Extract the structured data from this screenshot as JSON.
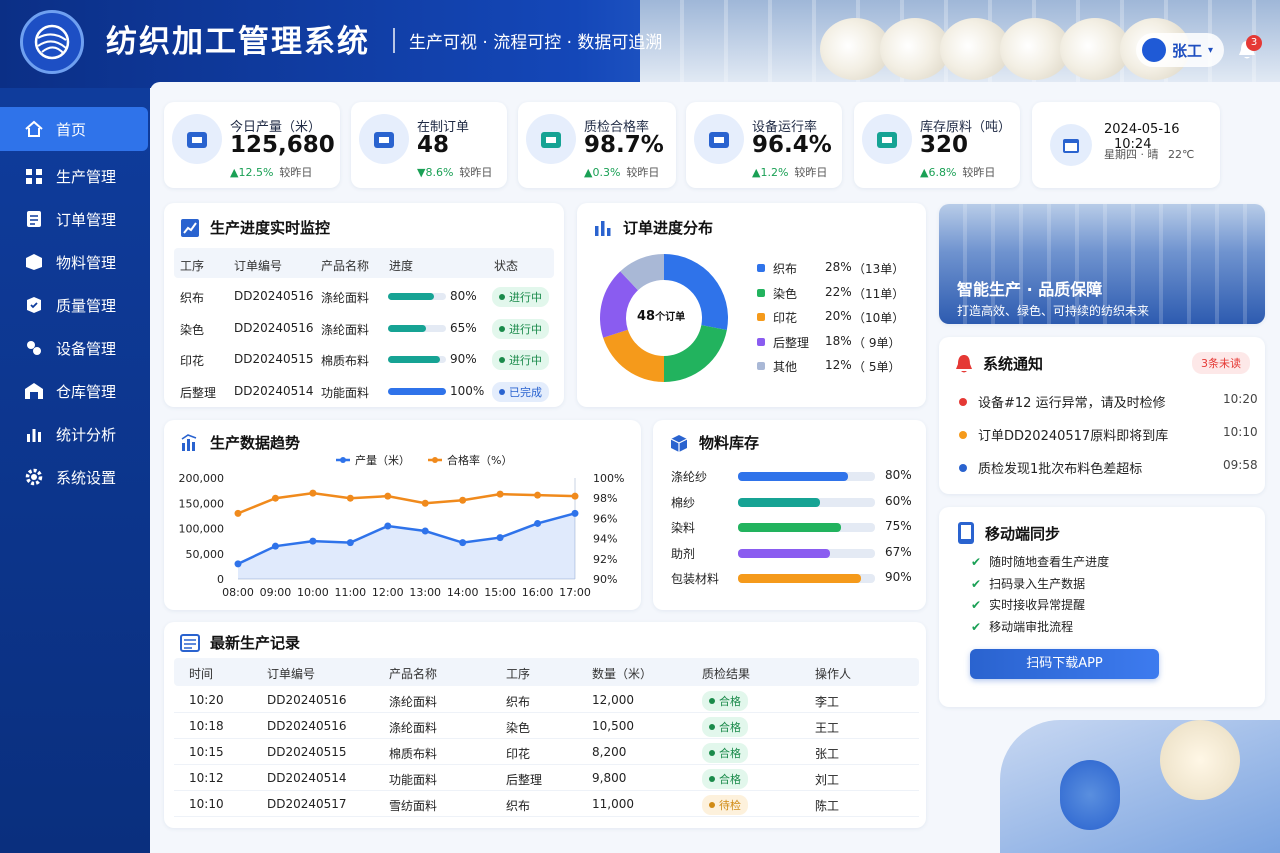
{
  "header": {
    "title": "纺织加工管理系统",
    "subtitle": "生产可视 · 流程可控 · 数据可追溯",
    "user": "张工",
    "notif_count": "3"
  },
  "sidebar": {
    "items": [
      {
        "label": "首页",
        "icon": "home-icon",
        "active": true
      },
      {
        "label": "生产管理",
        "icon": "production-icon"
      },
      {
        "label": "订单管理",
        "icon": "order-icon"
      },
      {
        "label": "物料管理",
        "icon": "material-icon"
      },
      {
        "label": "质量管理",
        "icon": "quality-icon"
      },
      {
        "label": "设备管理",
        "icon": "equipment-icon"
      },
      {
        "label": "仓库管理",
        "icon": "warehouse-icon"
      },
      {
        "label": "统计分析",
        "icon": "chart-icon"
      },
      {
        "label": "系统设置",
        "icon": "gear-icon"
      }
    ]
  },
  "kpis": [
    {
      "label": "今日产量（米）",
      "value": "125,680",
      "change": "▲12.5%",
      "cmp": "较昨日",
      "icon": "factory-icon",
      "color": "#2a63cf"
    },
    {
      "label": "在制订单",
      "value": "48",
      "change": "▼8.6%",
      "cmp": "较昨日",
      "icon": "clipboard-icon",
      "color": "#2a63cf"
    },
    {
      "label": "质检合格率",
      "value": "98.7%",
      "change": "▲0.3%",
      "cmp": "较昨日",
      "icon": "check-badge-icon",
      "color": "#16a394"
    },
    {
      "label": "设备运行率",
      "value": "96.4%",
      "change": "▲1.2%",
      "cmp": "较昨日",
      "icon": "gear-icon",
      "color": "#2a63cf"
    },
    {
      "label": "库存原料（吨）",
      "value": "320",
      "change": "▲6.8%",
      "cmp": "较昨日",
      "icon": "box-icon",
      "color": "#16a394"
    }
  ],
  "datetime": {
    "date": "2024-05-16",
    "time": "10:24",
    "weekday": "星期四",
    "weather": "晴",
    "temp": "22℃"
  },
  "progress": {
    "title": "生产进度实时监控",
    "headers": [
      "工序",
      "订单编号",
      "产品名称",
      "进度",
      "状态"
    ],
    "rows": [
      {
        "step": "织布",
        "order": "DD20240516",
        "product": "涤纶面料",
        "pct": "80%",
        "frac": 0.8,
        "status": "进行中",
        "kind": "run"
      },
      {
        "step": "染色",
        "order": "DD20240516",
        "product": "涤纶面料",
        "pct": "65%",
        "frac": 0.65,
        "status": "进行中",
        "kind": "run"
      },
      {
        "step": "印花",
        "order": "DD20240515",
        "product": "棉质布料",
        "pct": "90%",
        "frac": 0.9,
        "status": "进行中",
        "kind": "run"
      },
      {
        "step": "后整理",
        "order": "DD20240514",
        "product": "功能面料",
        "pct": "100%",
        "frac": 1.0,
        "status": "已完成",
        "kind": "done"
      }
    ]
  },
  "order_dist": {
    "title": "订单进度分布",
    "center_value": "48",
    "center_unit": "个订单",
    "slices": [
      {
        "name": "织布",
        "pct": "28%",
        "count": "（13单）",
        "value": 28,
        "color": "#2f73ea"
      },
      {
        "name": "染色",
        "pct": "22%",
        "count": "（11单）",
        "value": 22,
        "color": "#22b35e"
      },
      {
        "name": "印花",
        "pct": "20%",
        "count": "（10单）",
        "value": 20,
        "color": "#f59a1b"
      },
      {
        "name": "后整理",
        "pct": "18%",
        "count": "（ 9单）",
        "value": 18,
        "color": "#8a5cf0"
      },
      {
        "name": "其他",
        "pct": "12%",
        "count": "（ 5单）",
        "value": 12,
        "color": "#a9b8d6"
      }
    ]
  },
  "banner": {
    "title": "智能生产 · 品质保障",
    "sub": "打造高效、绿色、可持续的纺织未来"
  },
  "notices": {
    "title": "系统通知",
    "badge": "3条未读",
    "items": [
      {
        "text": "设备#12 运行异常，请及时检修",
        "time": "10:20",
        "color": "#e53935"
      },
      {
        "text": "订单DD20240517原料即将到库",
        "time": "10:10",
        "color": "#f59a1b"
      },
      {
        "text": "质检发现1批次布料色差超标",
        "time": "09:58",
        "color": "#2a63cf"
      }
    ]
  },
  "trend": {
    "title": "生产数据趋势",
    "legend": [
      "产量（米）",
      "合格率（%）"
    ]
  },
  "chart_data": {
    "type": "line",
    "x": [
      "08:00",
      "09:00",
      "10:00",
      "11:00",
      "12:00",
      "13:00",
      "14:00",
      "15:00",
      "16:00",
      "17:00"
    ],
    "series": [
      {
        "name": "产量（米）",
        "axis": "left",
        "color": "#2f73ea",
        "values": [
          30000,
          65000,
          75000,
          72000,
          105000,
          95000,
          72000,
          82000,
          110000,
          130000
        ]
      },
      {
        "name": "合格率（%）",
        "axis": "right",
        "color": "#f08a1c",
        "values": [
          96.5,
          98,
          98.5,
          98,
          98.2,
          97.5,
          97.8,
          98.4,
          98.3,
          98.2
        ]
      }
    ],
    "yleft": {
      "ticks": [
        "0",
        "50,000",
        "100,000",
        "150,000",
        "200,000"
      ],
      "min": 0,
      "max": 200000
    },
    "yright": {
      "ticks": [
        "90%",
        "92%",
        "94%",
        "96%",
        "98%",
        "100%"
      ],
      "min": 90,
      "max": 100
    }
  },
  "inventory": {
    "title": "物料库存",
    "items": [
      {
        "name": "涤纶纱",
        "pct": "80%",
        "frac": 0.8,
        "color": "#2f73ea"
      },
      {
        "name": "棉纱",
        "pct": "60%",
        "frac": 0.6,
        "color": "#16a394"
      },
      {
        "name": "染料",
        "pct": "75%",
        "frac": 0.75,
        "color": "#22b35e"
      },
      {
        "name": "助剂",
        "pct": "67%",
        "frac": 0.67,
        "color": "#8a5cf0"
      },
      {
        "name": "包装材料",
        "pct": "90%",
        "frac": 0.9,
        "color": "#f59a1b"
      }
    ]
  },
  "mobile": {
    "title": "移动端同步",
    "items": [
      "随时随地查看生产进度",
      "扫码录入生产数据",
      "实时接收异常提醒",
      "移动端审批流程"
    ],
    "button": "扫码下载APP"
  },
  "records": {
    "title": "最新生产记录",
    "headers": [
      "时间",
      "订单编号",
      "产品名称",
      "工序",
      "数量（米）",
      "质检结果",
      "操作人"
    ],
    "rows": [
      {
        "time": "10:20",
        "order": "DD20240516",
        "product": "涤纶面料",
        "step": "织布",
        "qty": "12,000",
        "result": "合格",
        "kind": "ok",
        "op": "李工"
      },
      {
        "time": "10:18",
        "order": "DD20240516",
        "product": "涤纶面料",
        "step": "染色",
        "qty": "10,500",
        "result": "合格",
        "kind": "ok",
        "op": "王工"
      },
      {
        "time": "10:15",
        "order": "DD20240515",
        "product": "棉质布料",
        "step": "印花",
        "qty": "8,200",
        "result": "合格",
        "kind": "ok",
        "op": "张工"
      },
      {
        "time": "10:12",
        "order": "DD20240514",
        "product": "功能面料",
        "step": "后整理",
        "qty": "9,800",
        "result": "合格",
        "kind": "ok",
        "op": "刘工"
      },
      {
        "time": "10:10",
        "order": "DD20240517",
        "product": "雪纺面料",
        "step": "织布",
        "qty": "11,000",
        "result": "待检",
        "kind": "wait",
        "op": "陈工"
      }
    ]
  }
}
